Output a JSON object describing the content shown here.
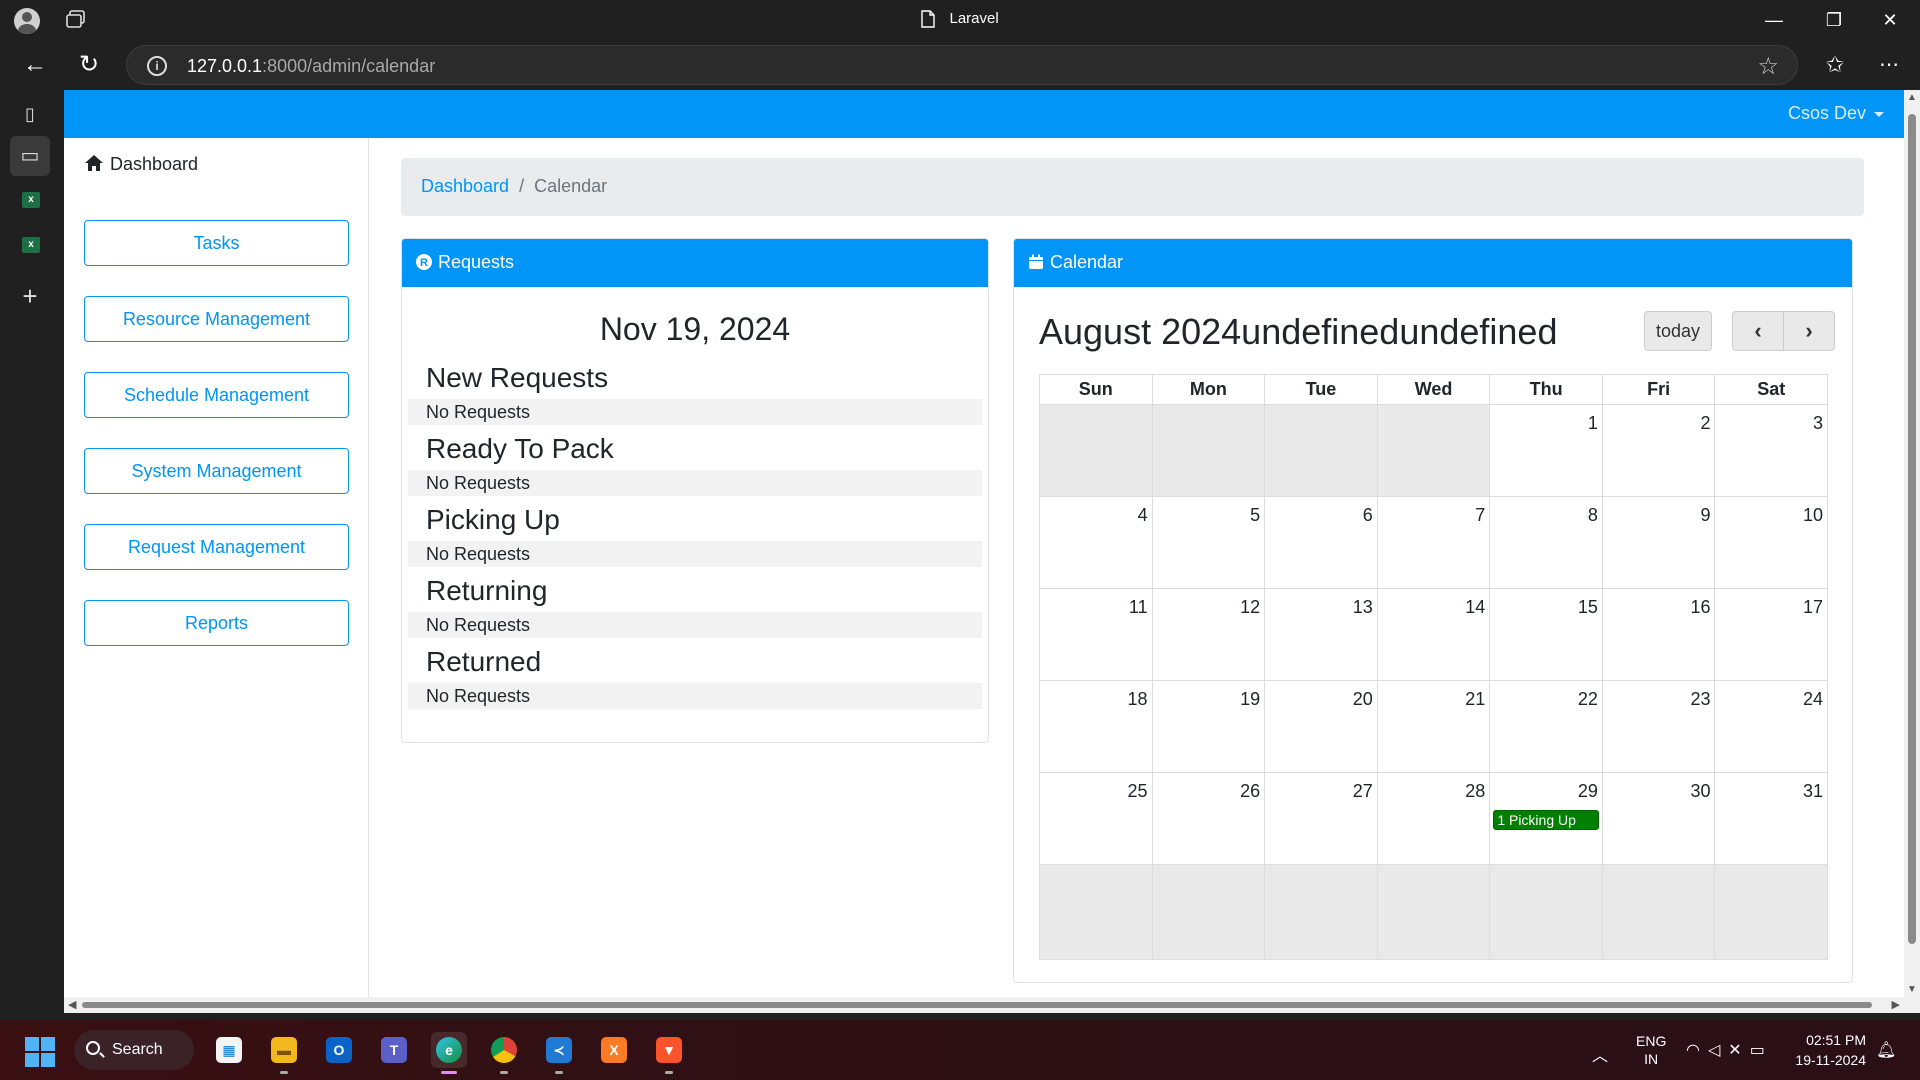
{
  "browser": {
    "tab_title": "Laravel",
    "url_host": "127.0.0.1",
    "url_rest": ":8000/admin/calendar",
    "window_controls": {
      "minimize": "—",
      "maximize": "❐",
      "close": "✕"
    }
  },
  "navbar": {
    "user_label": "Csos Dev"
  },
  "sidebar": {
    "dashboard_label": "Dashboard",
    "buttons": [
      "Tasks",
      "Resource Management",
      "Schedule Management",
      "System Management",
      "Request Management",
      "Reports"
    ]
  },
  "breadcrumb": {
    "home": "Dashboard",
    "separator": "/",
    "current": "Calendar"
  },
  "requests": {
    "header": "Requests",
    "date": "Nov 19, 2024",
    "sections": [
      {
        "title": "New Requests",
        "status": "No Requests"
      },
      {
        "title": "Ready To Pack",
        "status": "No Requests"
      },
      {
        "title": "Picking Up",
        "status": "No Requests"
      },
      {
        "title": "Returning",
        "status": "No Requests"
      },
      {
        "title": "Returned",
        "status": "No Requests"
      }
    ]
  },
  "calendar": {
    "header": "Calendar",
    "title": "August 2024undefinedundefined",
    "today_label": "today",
    "prev_label": "‹",
    "next_label": "›",
    "weekdays": [
      "Sun",
      "Mon",
      "Tue",
      "Wed",
      "Thu",
      "Fri",
      "Sat"
    ],
    "weeks": [
      [
        "",
        "",
        "",
        "",
        "1",
        "2",
        "3"
      ],
      [
        "4",
        "5",
        "6",
        "7",
        "8",
        "9",
        "10"
      ],
      [
        "11",
        "12",
        "13",
        "14",
        "15",
        "16",
        "17"
      ],
      [
        "18",
        "19",
        "20",
        "21",
        "22",
        "23",
        "24"
      ],
      [
        "25",
        "26",
        "27",
        "28",
        "29",
        "30",
        "31"
      ],
      [
        "",
        "",
        "",
        "",
        "",
        "",
        ""
      ]
    ],
    "event": {
      "day": "29",
      "label": "1 Picking Up",
      "color": "#008000"
    }
  },
  "taskbar": {
    "search_label": "Search",
    "apps": [
      "windows-explorer",
      "file-explorer",
      "outlook",
      "teams",
      "edge",
      "chrome",
      "vscode",
      "xampp",
      "brave"
    ],
    "lang_line1": "ENG",
    "lang_line2": "IN",
    "time": "02:51 PM",
    "date": "19-11-2024"
  },
  "colors": {
    "accent": "#0095f6",
    "event": "#008000"
  }
}
